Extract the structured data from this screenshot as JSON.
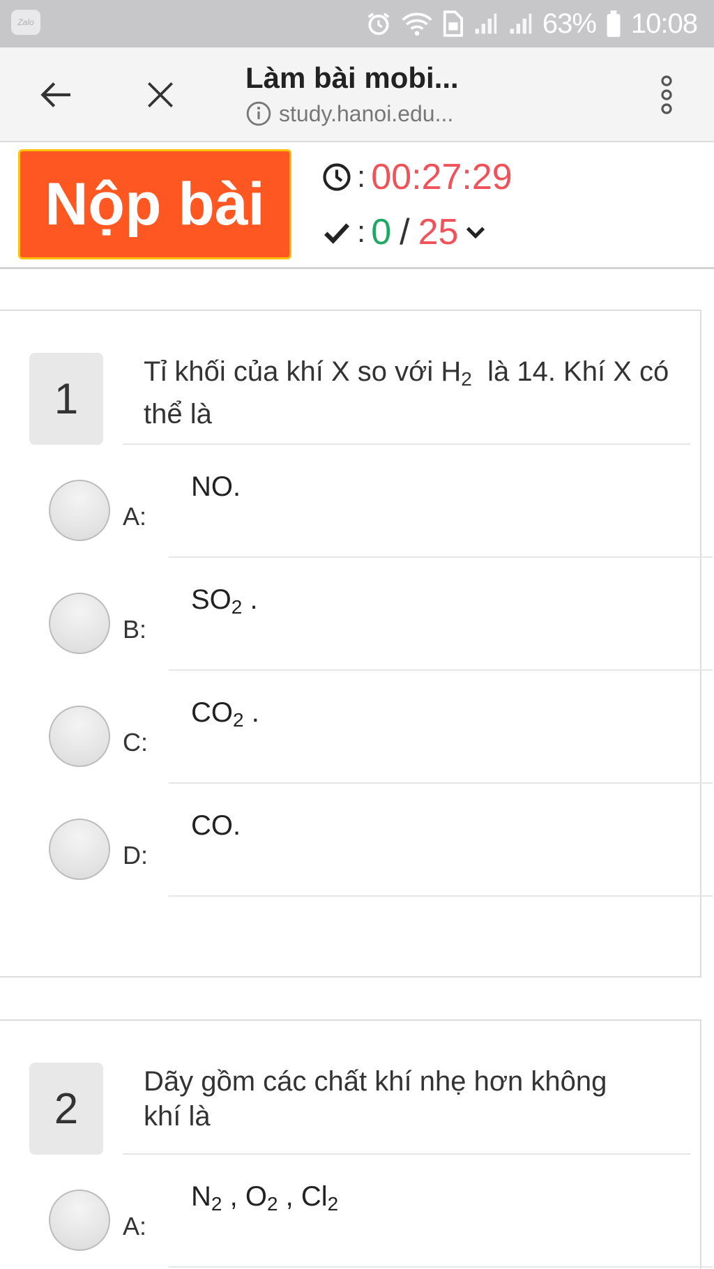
{
  "status_bar": {
    "app_icon": "zalo-icon",
    "app_icon_text": "Zalo",
    "battery_percent": "63%",
    "time": "10:08",
    "icons": [
      "alarm-icon",
      "wifi-icon",
      "sim-icon",
      "signal-icon",
      "signal-icon",
      "battery-icon"
    ]
  },
  "browser": {
    "title": "Làm bài mobi...",
    "url": "study.hanoi.edu...",
    "back_icon": "back-arrow-icon",
    "close_icon": "close-icon",
    "menu_icon": "more-vert-icon"
  },
  "quiz_header": {
    "submit_label": "Nộp bài",
    "timer_colon": ":",
    "timer": "00:27:29",
    "progress_colon": ":",
    "answered": "0",
    "separator": "/",
    "total": "25"
  },
  "questions": [
    {
      "number": "1",
      "text_before": "Tỉ khối của khí X so với H",
      "text_sub": "2",
      "text_after": "  là 14. Khí X có thể là",
      "options": [
        {
          "letter": "A:",
          "text": "NO."
        },
        {
          "letter": "B:",
          "main": "SO",
          "sub": "2",
          "tail": " ."
        },
        {
          "letter": "C:",
          "main": "CO",
          "sub": "2",
          "tail": " ."
        },
        {
          "letter": "D:",
          "text": "CO."
        }
      ]
    },
    {
      "number": "2",
      "text": "Dãy gồm các chất khí nhẹ hơn không khí là",
      "options": [
        {
          "letter": "A:",
          "parts": [
            {
              "main": "N",
              "sub": "2"
            },
            {
              "sep": " , "
            },
            {
              "main": "O",
              "sub": "2"
            },
            {
              "sep": " , "
            },
            {
              "main": "Cl",
              "sub": "2"
            }
          ]
        }
      ]
    }
  ],
  "colors": {
    "submit_bg": "#ff5722",
    "submit_border": "#ffc107",
    "timer": "#f0525a",
    "answered": "#1ea863",
    "total": "#f0525a"
  }
}
